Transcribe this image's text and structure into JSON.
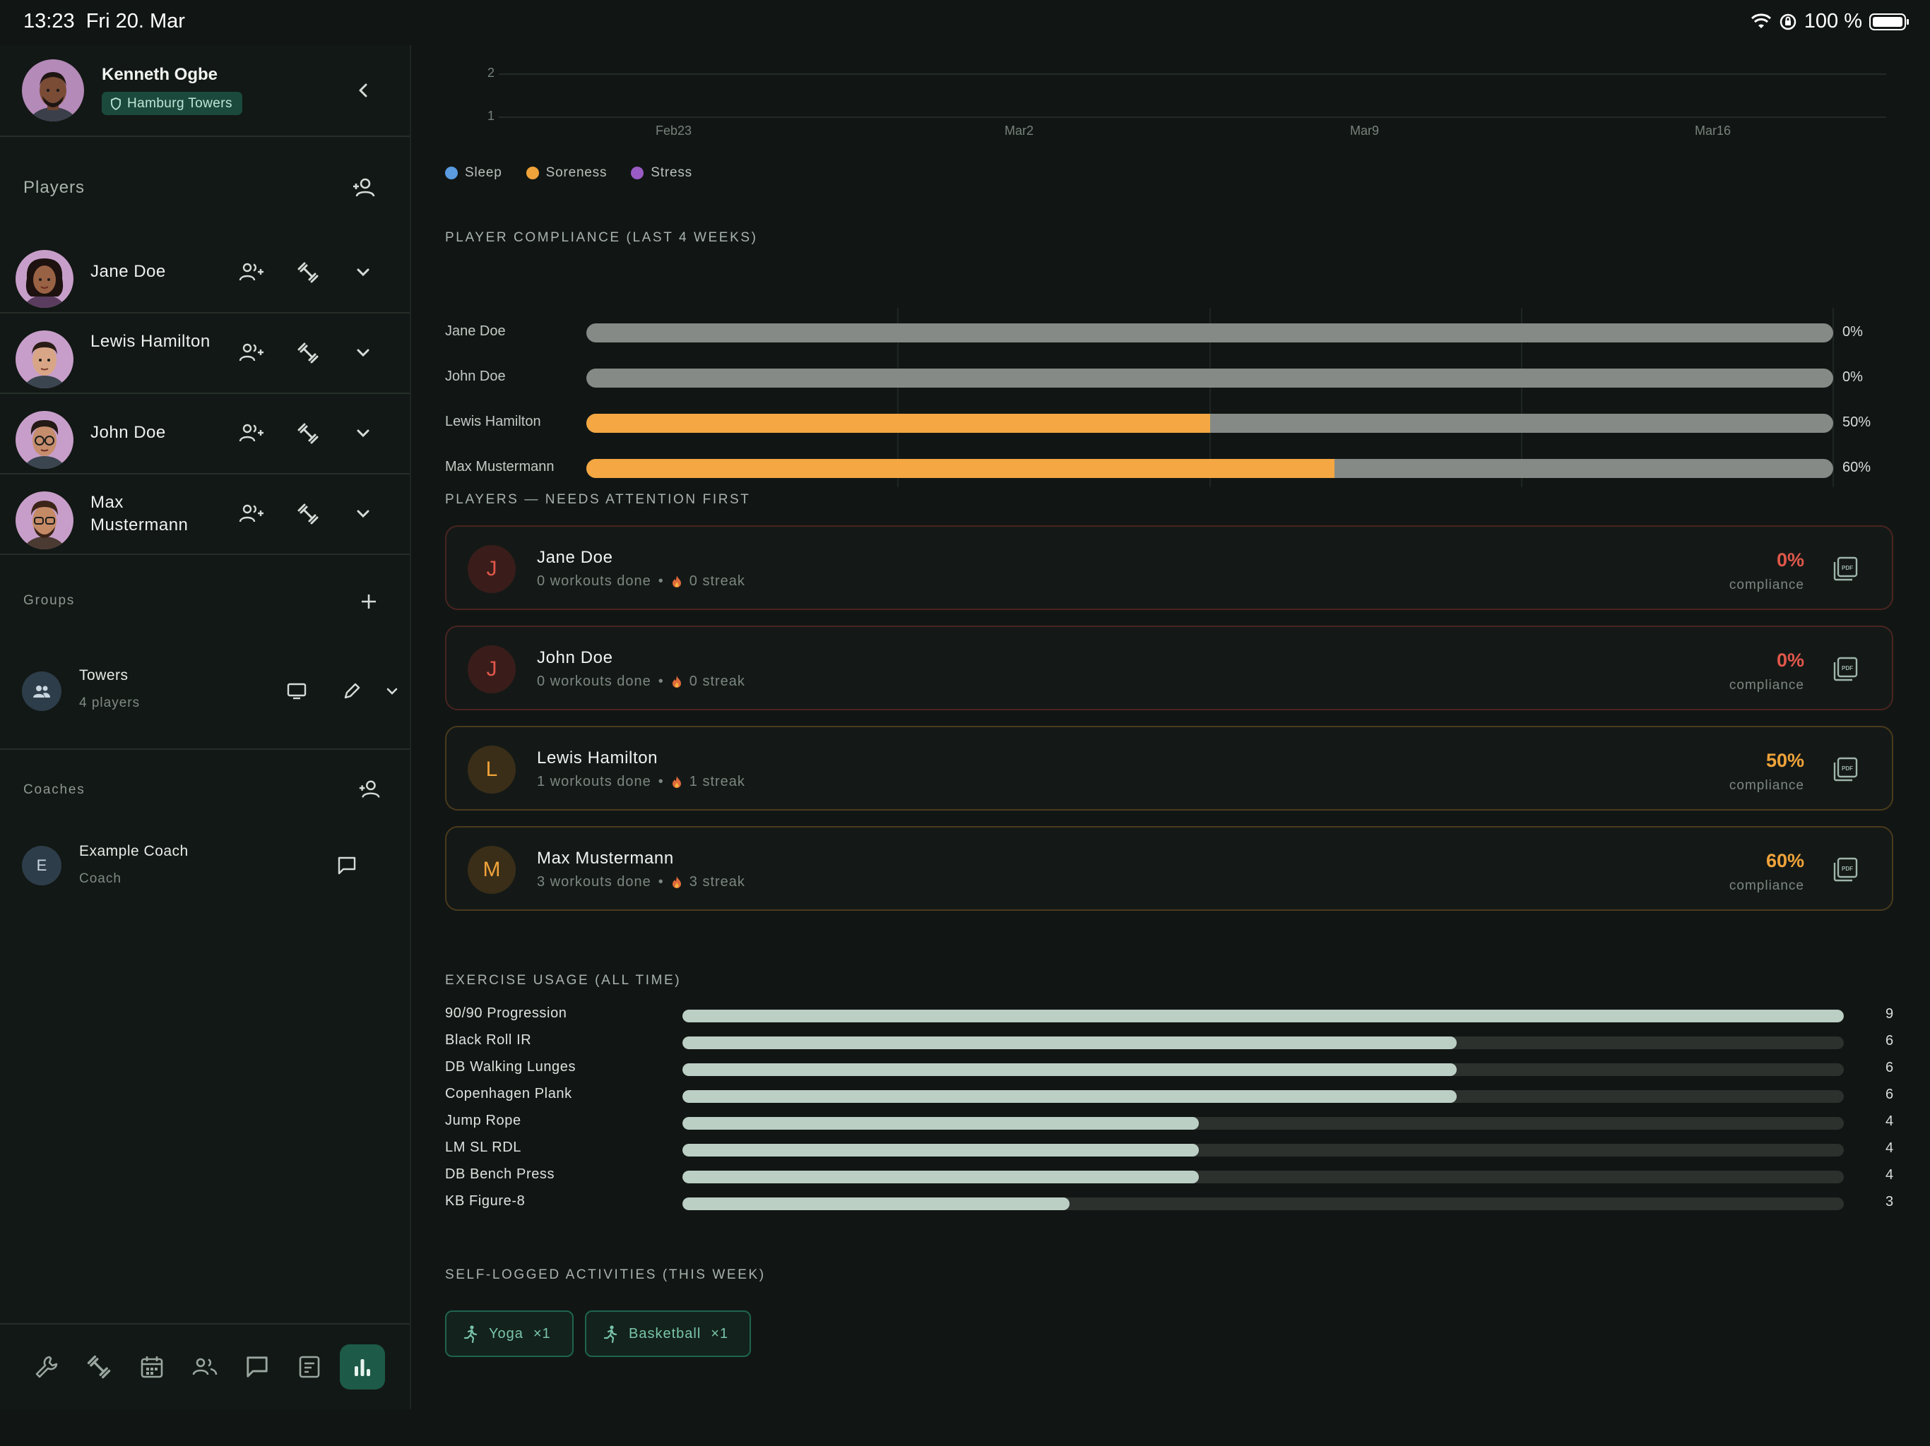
{
  "status_bar": {
    "time": "13:23",
    "date": "Fri 20. Mar",
    "battery": "100 %"
  },
  "profile": {
    "name": "Kenneth Ogbe",
    "team": "Hamburg Towers"
  },
  "players_section": {
    "title": "Players",
    "items": [
      {
        "name": "Jane Doe"
      },
      {
        "name": "Lewis Hamilton"
      },
      {
        "name": "John Doe"
      },
      {
        "name": "Max Mustermann"
      }
    ]
  },
  "groups_section": {
    "title": "Groups",
    "items": [
      {
        "name": "Towers",
        "sub": "4 players"
      }
    ]
  },
  "coaches_section": {
    "title": "Coaches",
    "items": [
      {
        "initial": "E",
        "name": "Example Coach",
        "role": "Coach"
      }
    ]
  },
  "wellness_chart": {
    "y_ticks": [
      "2",
      "1"
    ],
    "x_ticks": [
      "Feb23",
      "Mar2",
      "Mar9",
      "Mar16"
    ],
    "legend": [
      {
        "label": "Sleep",
        "color": "#5b9be0"
      },
      {
        "label": "Soreness",
        "color": "#f0a33a"
      },
      {
        "label": "Stress",
        "color": "#9a5bc4"
      }
    ]
  },
  "compliance": {
    "title": "PLAYER COMPLIANCE (LAST 4 WEEKS)",
    "rows": [
      {
        "name": "Jane Doe",
        "value": 0,
        "label": "0%"
      },
      {
        "name": "John Doe",
        "value": 0,
        "label": "0%"
      },
      {
        "name": "Lewis Hamilton",
        "value": 50,
        "label": "50%"
      },
      {
        "name": "Max Mustermann",
        "value": 60,
        "label": "60%"
      }
    ]
  },
  "attention": {
    "title": "PLAYERS — NEEDS ATTENTION FIRST",
    "compliance_word": "compliance",
    "cards": [
      {
        "initial": "J",
        "name": "Jane Doe",
        "workouts": "0 workouts done",
        "streak": "0 streak",
        "pct": "0%",
        "accent": "#e0574a",
        "border": "#4a2420",
        "circle": "#3a1d1a"
      },
      {
        "initial": "J",
        "name": "John Doe",
        "workouts": "0 workouts done",
        "streak": "0 streak",
        "pct": "0%",
        "accent": "#e0574a",
        "border": "#4a2420",
        "circle": "#3a1d1a"
      },
      {
        "initial": "L",
        "name": "Lewis Hamilton",
        "workouts": "1 workouts done",
        "streak": "1 streak",
        "pct": "50%",
        "accent": "#f0a33a",
        "border": "#4a3a1c",
        "circle": "#3a2e18"
      },
      {
        "initial": "M",
        "name": "Max Mustermann",
        "workouts": "3 workouts done",
        "streak": "3 streak",
        "pct": "60%",
        "accent": "#f0a33a",
        "border": "#4a3a1c",
        "circle": "#3a2e18"
      }
    ]
  },
  "exercise_usage": {
    "title": "EXERCISE USAGE (ALL TIME)",
    "max": 9,
    "rows": [
      {
        "name": "90/90 Progression",
        "count": 9
      },
      {
        "name": "Black Roll IR",
        "count": 6
      },
      {
        "name": "DB Walking Lunges",
        "count": 6
      },
      {
        "name": "Copenhagen Plank",
        "count": 6
      },
      {
        "name": "Jump Rope",
        "count": 4
      },
      {
        "name": "LM SL RDL",
        "count": 4
      },
      {
        "name": "DB Bench Press",
        "count": 4
      },
      {
        "name": "KB Figure-8",
        "count": 3
      }
    ]
  },
  "self_logged": {
    "title": "SELF-LOGGED ACTIVITIES (THIS WEEK)",
    "chips": [
      {
        "label": "Yoga",
        "count": "×1"
      },
      {
        "label": "Basketball",
        "count": "×1"
      }
    ]
  }
}
